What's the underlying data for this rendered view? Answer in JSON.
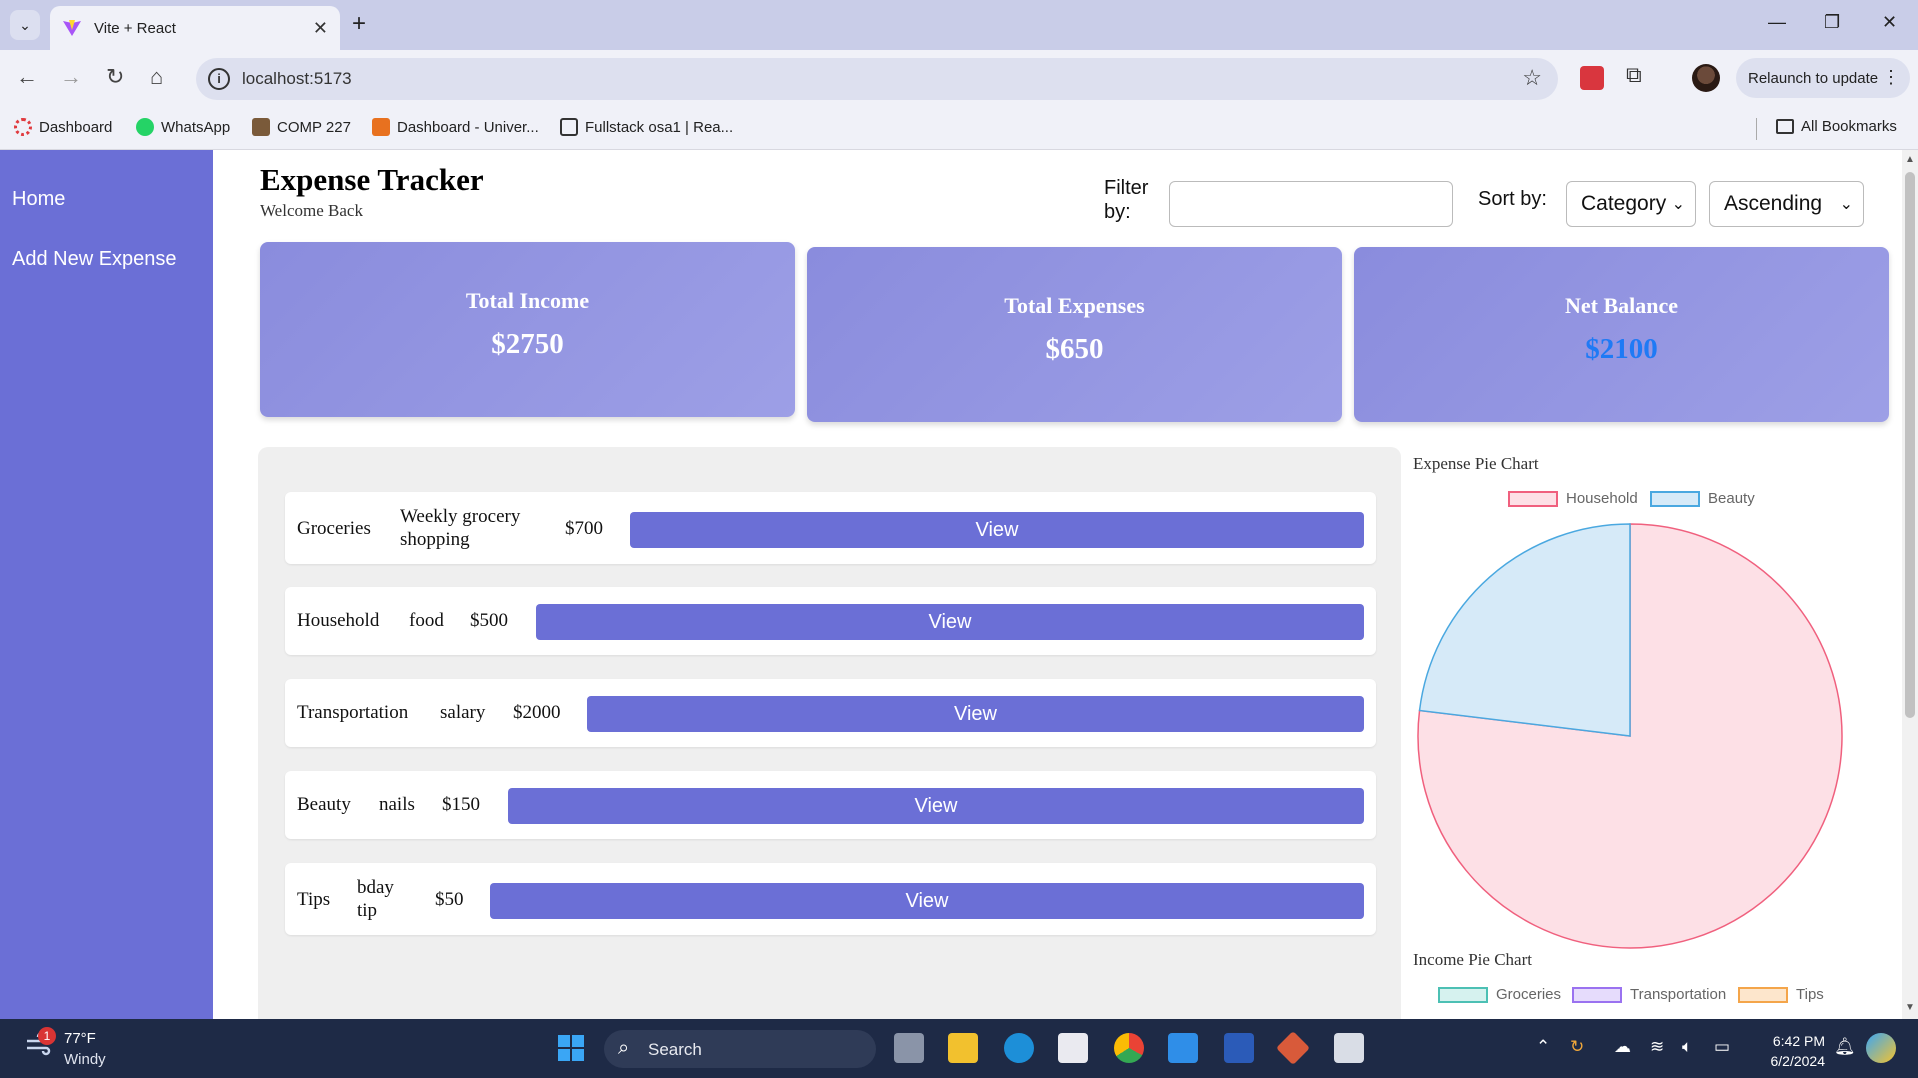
{
  "browser": {
    "tab_title": "Vite + React",
    "url": "localhost:5173",
    "relaunch_label": "Relaunch to update",
    "bookmarks": [
      {
        "label": "Dashboard",
        "color": "#e03a3e"
      },
      {
        "label": "WhatsApp",
        "color": "#25d366"
      },
      {
        "label": "COMP 227",
        "color": "#7a5a3a"
      },
      {
        "label": "Dashboard - Univer...",
        "color": "#e8711f"
      },
      {
        "label": "Fullstack osa1 | Rea...",
        "color": "#333333"
      }
    ],
    "all_bookmarks": "All Bookmarks"
  },
  "sidebar": {
    "items": [
      {
        "label": "Home"
      },
      {
        "label": "Add New Expense"
      }
    ]
  },
  "header": {
    "title": "Expense Tracker",
    "subtitle": "Welcome Back",
    "filter_label": "Filter by:",
    "filter_value": "",
    "sort_label": "Sort by:",
    "sort_field": "Category",
    "sort_order": "Ascending"
  },
  "summary": {
    "income_label": "Total Income",
    "income_value": "$2750",
    "expenses_label": "Total Expenses",
    "expenses_value": "$650",
    "net_label": "Net Balance",
    "net_value": "$2100"
  },
  "transactions": [
    {
      "category": "Groceries",
      "description": "Weekly grocery shopping",
      "amount": "$700",
      "action": "View"
    },
    {
      "category": "Household",
      "description": "food",
      "amount": "$500",
      "action": "View"
    },
    {
      "category": "Transportation",
      "description": "salary",
      "amount": "$2000",
      "action": "View"
    },
    {
      "category": "Beauty",
      "description": "nails",
      "amount": "$150",
      "action": "View"
    },
    {
      "category": "Tips",
      "description": "bday tip",
      "amount": "$50",
      "action": "View"
    }
  ],
  "chart_data": [
    {
      "type": "pie",
      "title": "Expense Pie Chart",
      "categories": [
        "Household",
        "Beauty"
      ],
      "values": [
        500,
        150
      ],
      "colors": {
        "fill": [
          "#fde0e6",
          "#d6eaf8"
        ],
        "stroke": [
          "#f0607e",
          "#4aa8e0"
        ]
      },
      "legend": "top"
    },
    {
      "type": "pie",
      "title": "Income Pie Chart",
      "categories": [
        "Groceries",
        "Transportation",
        "Tips"
      ],
      "colors": {
        "fill": [
          "#d6f2ef",
          "#e6dcfc",
          "#fde6cc"
        ],
        "stroke": [
          "#4cc0b4",
          "#9a72f0",
          "#f4a54a"
        ]
      },
      "legend": "top"
    }
  ],
  "taskbar": {
    "weather_temp": "77°F",
    "weather_desc": "Windy",
    "weather_badge": "1",
    "search_label": "Search",
    "time": "6:42 PM",
    "date": "6/2/2024"
  }
}
